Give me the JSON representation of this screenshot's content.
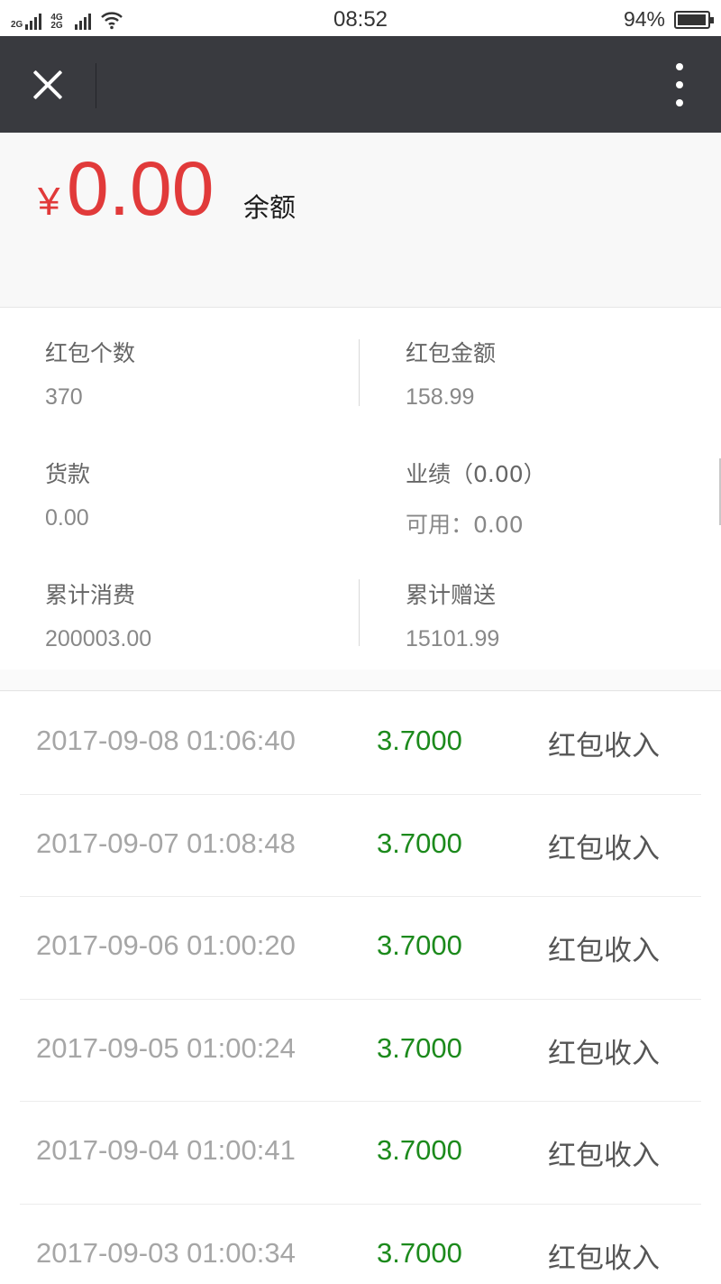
{
  "status_bar": {
    "sim1": "2G",
    "sim2": "4G 2G",
    "time": "08:52",
    "battery_percent": "94%",
    "battery_level": 0.94
  },
  "nav": {
    "close_icon": "close-icon",
    "more_icon": "more-vertical-icon"
  },
  "balance": {
    "currency": "¥",
    "amount": "0.00",
    "label": "余额",
    "accent_color": "#e13a3a"
  },
  "stats": {
    "hongbao_count": {
      "label": "红包个数",
      "value": "370"
    },
    "hongbao_amount": {
      "label": "红包金额",
      "value": "158.99"
    },
    "payment": {
      "label": "货款",
      "value": "0.00"
    },
    "performance": {
      "label": "业绩（0.00）",
      "available": "可用：0.00"
    },
    "total_spent": {
      "label": "累计消费",
      "value": "200003.00"
    },
    "total_gift": {
      "label": "累计赠送",
      "value": "15101.99"
    }
  },
  "records": [
    {
      "date": "2017-09-08 01:06:40",
      "amount": "3.7000",
      "type": "红包收入"
    },
    {
      "date": "2017-09-07 01:08:48",
      "amount": "3.7000",
      "type": "红包收入"
    },
    {
      "date": "2017-09-06 01:00:20",
      "amount": "3.7000",
      "type": "红包收入"
    },
    {
      "date": "2017-09-05 01:00:24",
      "amount": "3.7000",
      "type": "红包收入"
    },
    {
      "date": "2017-09-04 01:00:41",
      "amount": "3.7000",
      "type": "红包收入"
    },
    {
      "date": "2017-09-03 01:00:34",
      "amount": "3.7000",
      "type": "红包收入"
    }
  ],
  "colors": {
    "nav_bg": "#393a3f",
    "income_green": "#1c8a1c"
  }
}
